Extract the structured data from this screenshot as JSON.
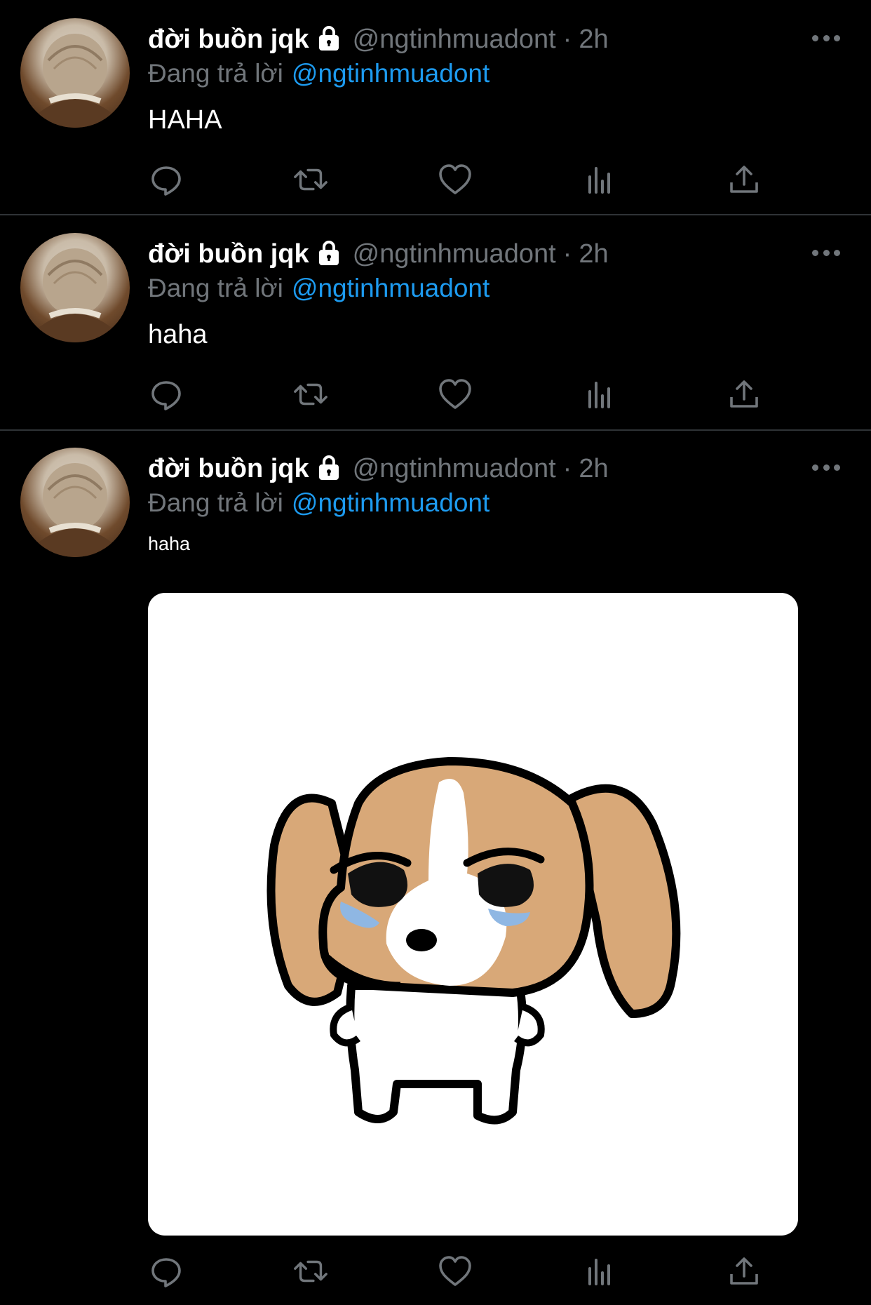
{
  "tweets": [
    {
      "name": "đời buồn jqk",
      "handle": "@ngtinhmuadont",
      "dot": "·",
      "time": "2h",
      "replying_label": "Đang trả lời",
      "replying_to": "@ngtinhmuadont",
      "text": "HAHA"
    },
    {
      "name": "đời buồn jqk",
      "handle": "@ngtinhmuadont",
      "dot": "·",
      "time": "2h",
      "replying_label": "Đang trả lời",
      "replying_to": "@ngtinhmuadont",
      "text": "haha"
    },
    {
      "name": "đời buồn jqk",
      "handle": "@ngtinhmuadont",
      "dot": "·",
      "time": "2h",
      "replying_label": "Đang trả lời",
      "replying_to": "@ngtinhmuadont",
      "text": "haha"
    }
  ],
  "icons": {
    "reply": "reply-icon",
    "retweet": "retweet-icon",
    "like": "heart-icon",
    "views": "analytics-icon",
    "share": "share-icon",
    "more": "more-icon",
    "lock": "lock-icon"
  },
  "colors": {
    "background": "#000000",
    "secondary_text": "#71767b",
    "mention": "#1d9bf0",
    "divider": "#2f3336"
  }
}
